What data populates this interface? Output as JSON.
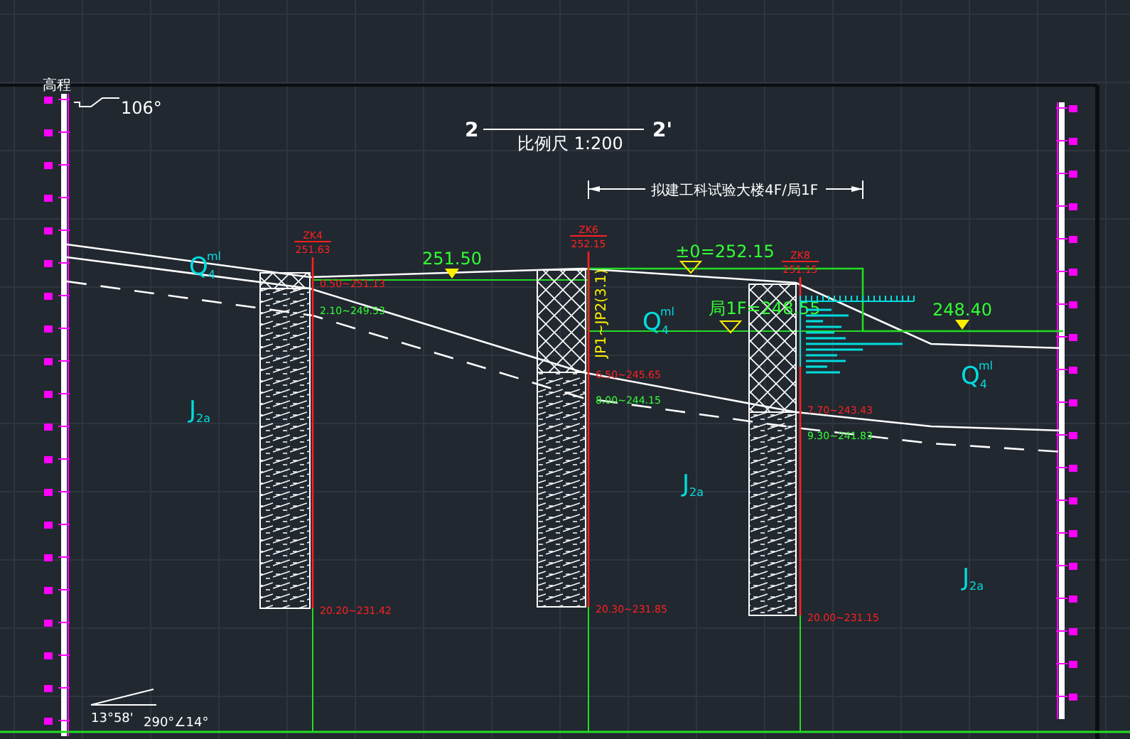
{
  "section": {
    "start": "2",
    "end": "2'",
    "scale": "比例尺  1:200"
  },
  "building": {
    "label": "拟建工科试验大楼4F/局1F"
  },
  "elevation_axis": {
    "title": "高程"
  },
  "orientation": {
    "bearing": "106°"
  },
  "elevation_marks": [
    {
      "text": "251.50"
    },
    {
      "text": "±0=252.15"
    },
    {
      "text": "局1F=248.55"
    },
    {
      "text": "248.40"
    }
  ],
  "boreholes": [
    {
      "id": "ZK4",
      "elevation": "251.63",
      "layers": [
        "0.50~251.13",
        "2.10~249.53"
      ],
      "bottom": "20.20~231.42"
    },
    {
      "id": "ZK6",
      "elevation": "252.15",
      "layers": [
        "6.50~245.65",
        "8.00~244.15"
      ],
      "bottom": "20.30~231.85"
    },
    {
      "id": "ZK8",
      "elevation": "251.15",
      "layers": [
        "7.70~243.43",
        "9.30~241.83"
      ],
      "bottom": "20.00~231.15"
    }
  ],
  "strata_labels": [
    {
      "symbol": "Q",
      "sub": "4",
      "sup": "ml"
    },
    {
      "symbol": "J",
      "sub": "2a"
    },
    {
      "symbol": "Q",
      "sub": "4",
      "sup": "ml"
    },
    {
      "symbol": "J",
      "sub": "2a"
    },
    {
      "symbol": "Q",
      "sub": "4",
      "sup": "ml"
    },
    {
      "symbol": "J",
      "sub": "2a"
    }
  ],
  "pile_label": "JP1~JP2(3.1)",
  "dip": {
    "angle": "13°58'",
    "attitude": "290°∠14°"
  }
}
